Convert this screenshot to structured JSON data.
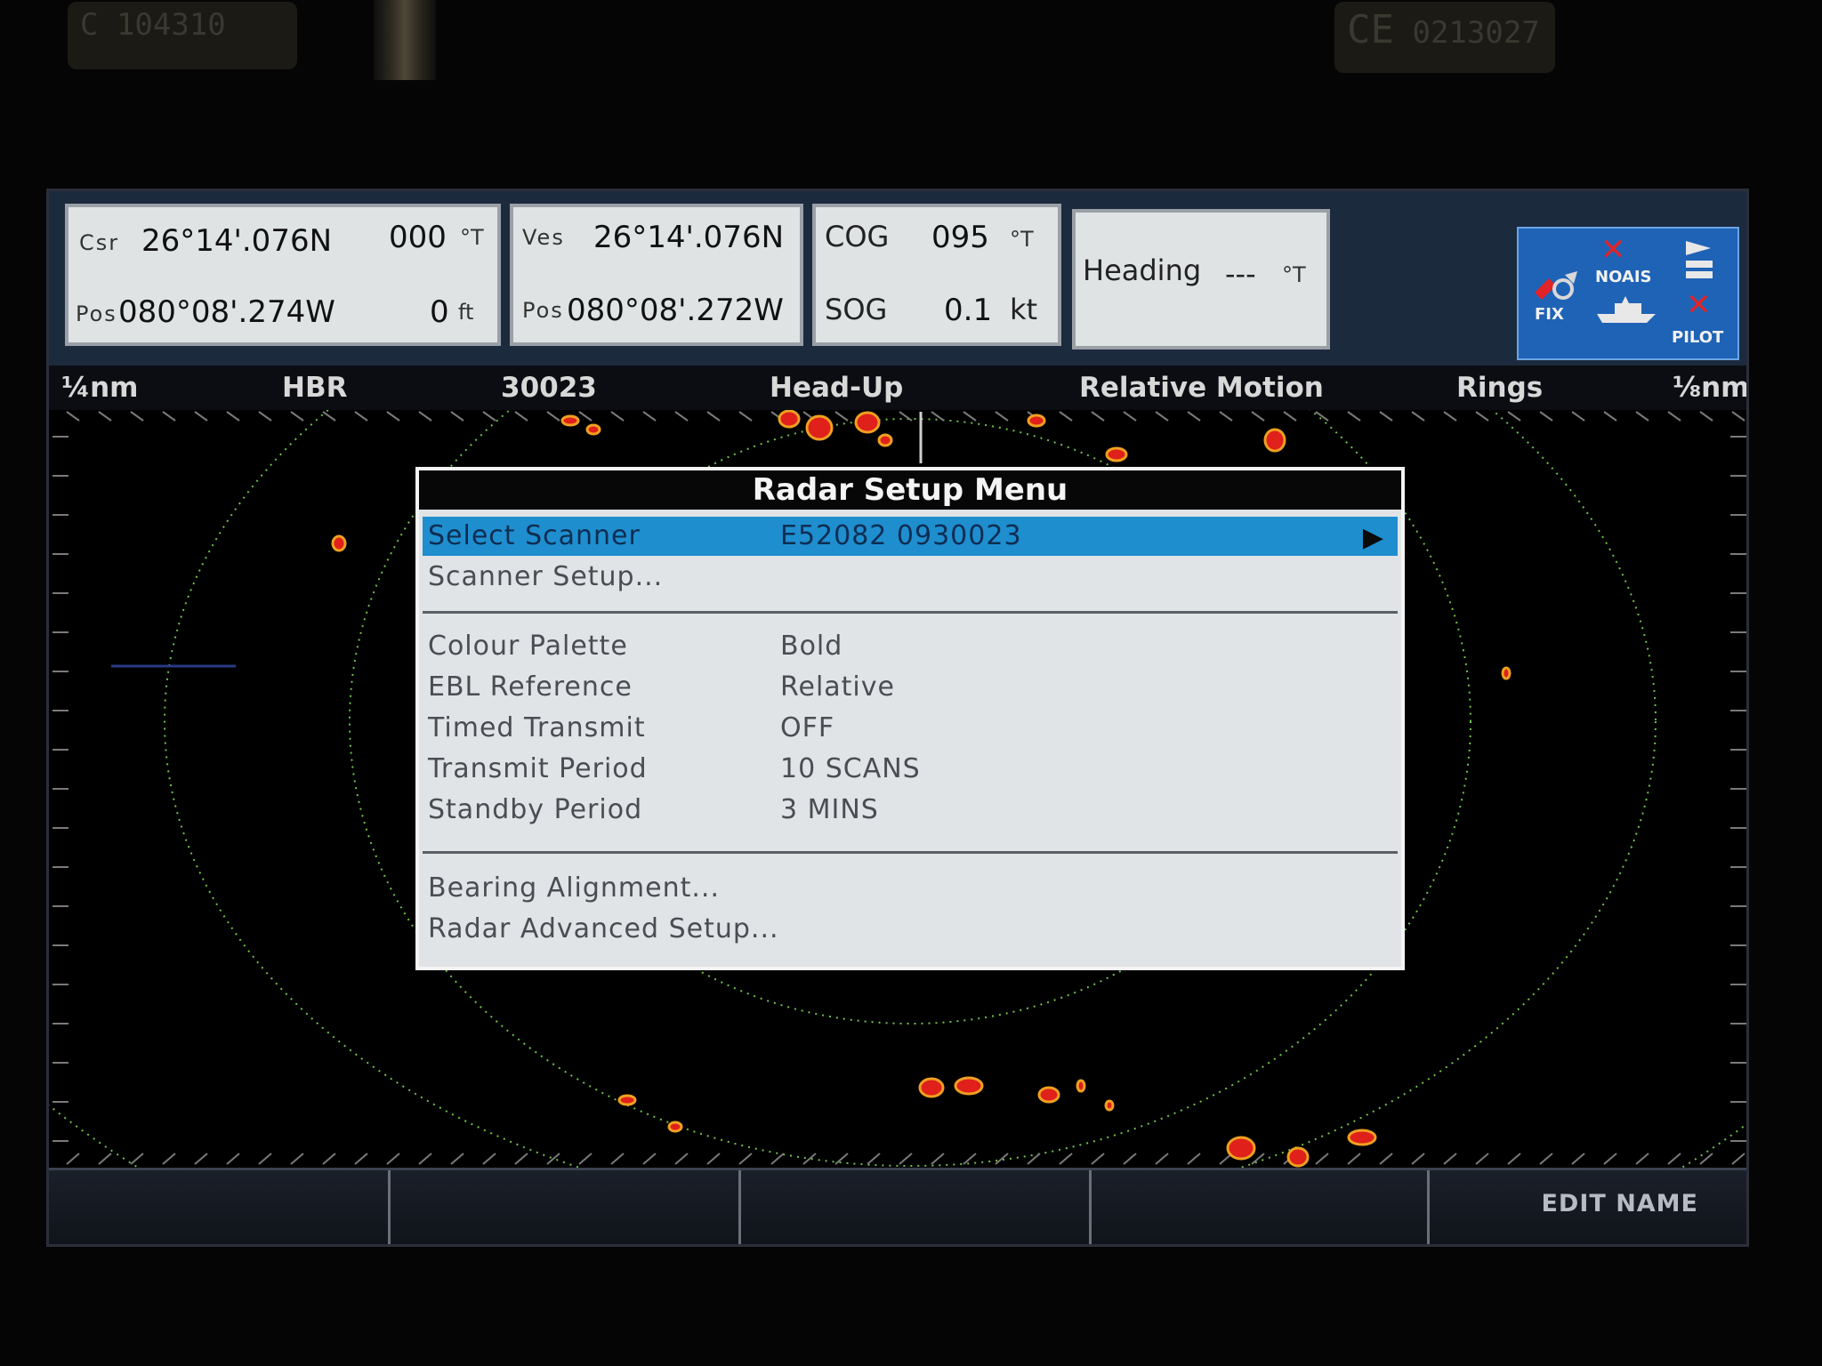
{
  "bezel": {
    "label_left": "C 104310",
    "label_right_top": "CE",
    "label_right_code": "0213027"
  },
  "databar": {
    "cursor": {
      "csr_label": "Csr",
      "pos_label": "Pos",
      "lat": "26°14'.076N",
      "lon": "080°08'.274W",
      "bearing": "000",
      "bearing_unit": "°T",
      "range": "0",
      "range_unit": "ft"
    },
    "vessel": {
      "ves_label": "Ves",
      "pos_label": "Pos",
      "lat": "26°14'.076N",
      "lon": "080°08'.272W"
    },
    "course": {
      "cog_label": "COG",
      "cog_value": "095",
      "cog_unit": "°T",
      "sog_label": "SOG",
      "sog_value": "0.1",
      "sog_unit": "kt"
    },
    "heading": {
      "label": "Heading",
      "value": "---",
      "unit": "°T"
    },
    "softicons": {
      "fix": "FIX",
      "noais": "NOAIS",
      "pilot": "PILOT"
    }
  },
  "statusbar": {
    "range_left": "¼nm",
    "mode": "HBR",
    "scanner": "30023",
    "orientation": "Head-Up",
    "motion": "Relative Motion",
    "rings_label": "Rings",
    "rings_range": "⅛nm"
  },
  "menu": {
    "title": "Radar Setup Menu",
    "selected": {
      "label": "Select Scanner",
      "value": "E52082 0930023"
    },
    "scanner_setup": "Scanner Setup...",
    "settings": [
      {
        "label": "Colour Palette",
        "value": "Bold"
      },
      {
        "label": "EBL Reference",
        "value": "Relative"
      },
      {
        "label": "Timed Transmit",
        "value": "OFF"
      },
      {
        "label": "Transmit Period",
        "value": "10 SCANS"
      },
      {
        "label": "Standby Period",
        "value": "3 MINS"
      }
    ],
    "bearing_alignment": "Bearing Alignment...",
    "advanced_setup": "Radar Advanced Setup..."
  },
  "softkeys": {
    "edit_name": "EDIT NAME"
  },
  "colors": {
    "ring": "#6fc24a",
    "echo_core": "#e0201a",
    "echo_edge": "#f0a020",
    "selection": "#1f8ecf"
  }
}
